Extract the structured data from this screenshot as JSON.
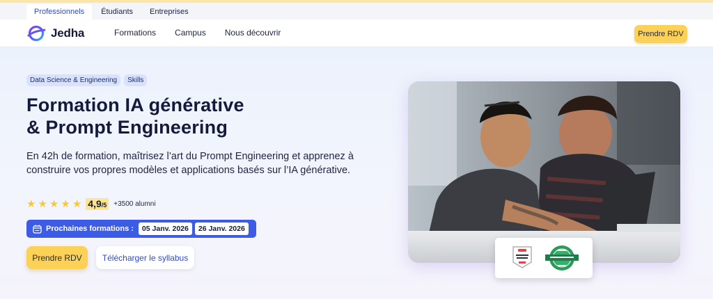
{
  "audience_tabs": [
    {
      "label": "Professionnels",
      "active": true
    },
    {
      "label": "Étudiants",
      "active": false
    },
    {
      "label": "Entreprises",
      "active": false
    }
  ],
  "brand": {
    "name": "Jedha",
    "accent": "#3d5ce6",
    "cta_color": "#fcd158"
  },
  "nav": {
    "links": [
      "Formations",
      "Campus",
      "Nous découvrir"
    ],
    "cta_label": "Prendre RDV"
  },
  "hero": {
    "chips": [
      "Data Science & Engineering",
      "Skills"
    ],
    "title_line1": "Formation IA générative",
    "title_line2": "& Prompt Engineering",
    "description": "En 42h de formation, maîtrisez l’art du Prompt Engineering et apprenez à construire vos propres modèles et applications basés sur l’IA générative.",
    "rating": {
      "stars": 5,
      "score": "4,9",
      "scale": "/5",
      "alumni": "+3500 alumni"
    },
    "next_sessions": {
      "label": "Prochaines formations :",
      "dates": [
        "05 Janv. 2026",
        "26 Janv. 2026"
      ]
    },
    "primary_cta": "Prendre RDV",
    "secondary_cta": "Télécharger le syllabus"
  },
  "badges": [
    {
      "name": "course-report-best-bootcamps-badge",
      "text": "BEST BOOTCAMPS",
      "year": "2023"
    },
    {
      "name": "switchup-best-bootcamp-badge",
      "text": "BEST BOOTCAMP"
    }
  ]
}
